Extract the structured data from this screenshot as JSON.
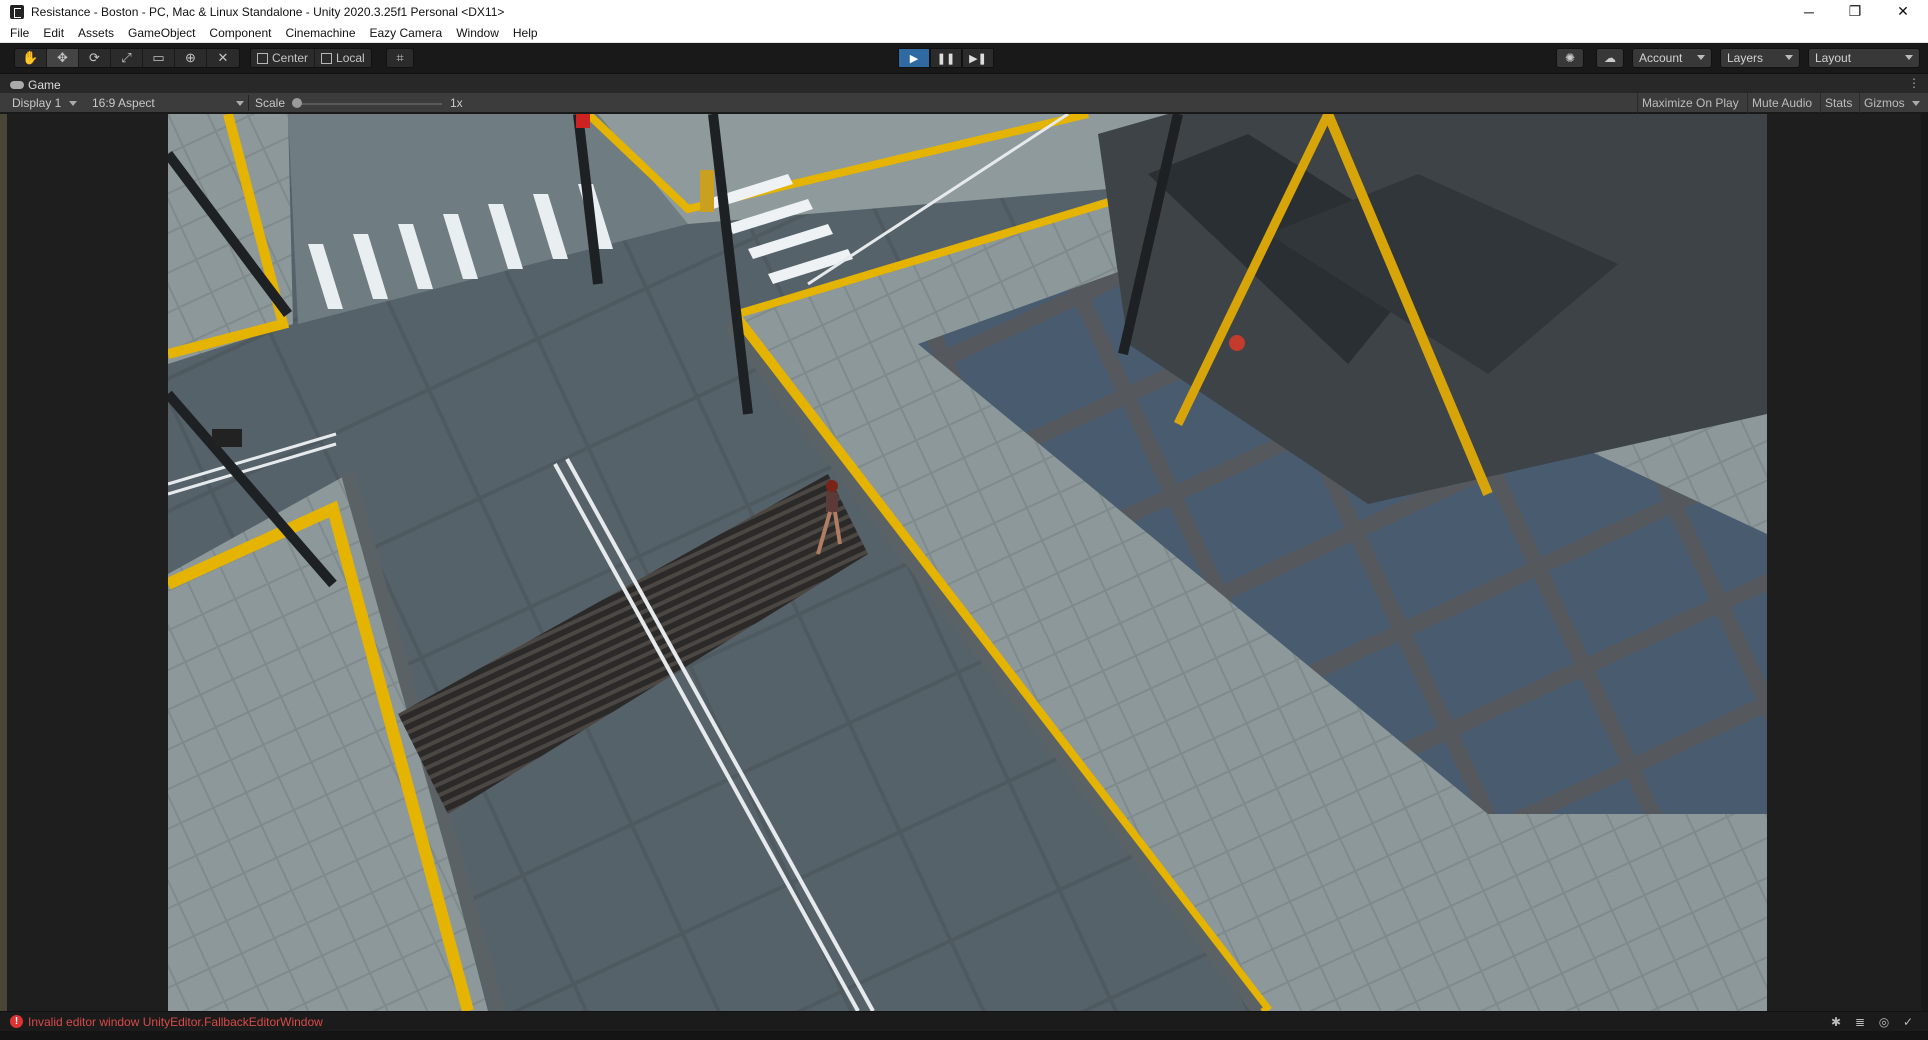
{
  "window": {
    "title": "Resistance - Boston - PC, Mac & Linux Standalone - Unity 2020.3.25f1 Personal <DX11>",
    "controls": {
      "minimize": "─",
      "restore": "❐",
      "close": "✕"
    }
  },
  "menu": {
    "items": [
      "File",
      "Edit",
      "Assets",
      "GameObject",
      "Component",
      "Cinemachine",
      "Eazy Camera",
      "Window",
      "Help"
    ]
  },
  "toolbar": {
    "tools": [
      "hand-tool-icon",
      "move-tool-icon",
      "rotate-tool-icon",
      "scale-tool-icon",
      "rect-tool-icon",
      "transform-tool-icon",
      "custom-tool-icon"
    ],
    "active_tool": "move-tool-icon",
    "pivot_mode": "Center",
    "pivot_rotation": "Local",
    "grid_snap_icon": "grid-snap-icon",
    "play": {
      "play": "▶",
      "pause": "❚❚",
      "step": "▶❚",
      "playing": true
    },
    "account": "Account",
    "layers": "Layers",
    "layout": "Layout"
  },
  "game_view": {
    "tab_label": "Game",
    "tab_menu": "⋮",
    "display": "Display 1",
    "aspect": "16:9 Aspect",
    "scale_label": "Scale",
    "scale_value": "1x",
    "scale_level": 0.0,
    "maximize_on_play": "Maximize On Play",
    "mute_audio": "Mute Audio",
    "stats": "Stats",
    "gizmos": "Gizmos"
  },
  "status": {
    "error_icon": "!",
    "error_text": "Invalid editor window UnityEditor.FallbackEditorWindow"
  },
  "colors": {
    "accent": "#2f6aa3",
    "error": "#d94a4a",
    "road_yellow": "#e6b800"
  }
}
